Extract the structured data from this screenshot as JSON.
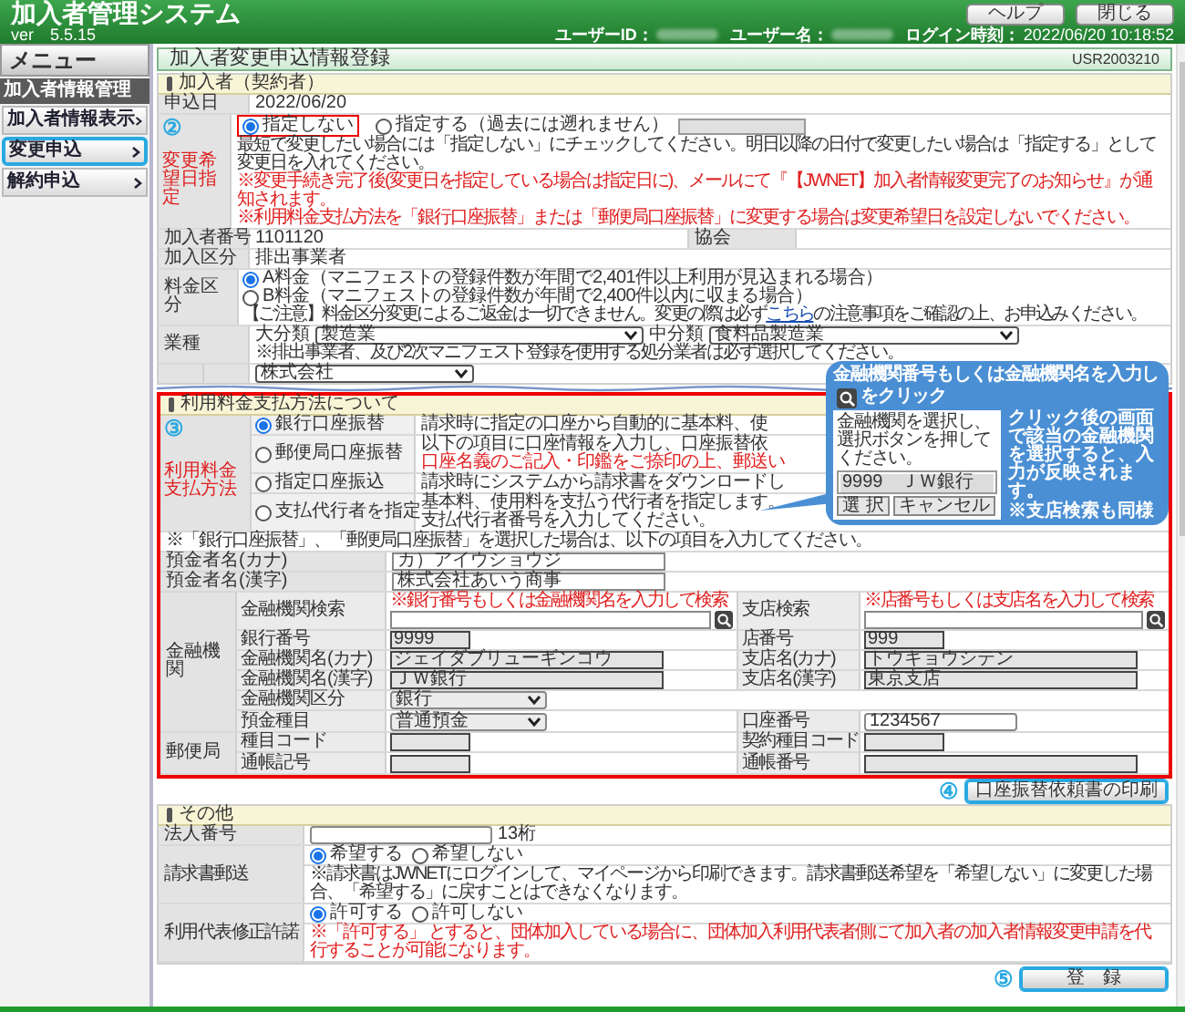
{
  "app": {
    "title": "加入者管理システム",
    "version": "ver　5.5.15",
    "buttons": [
      "ヘルプ",
      "閉じる"
    ],
    "user_id_label": "ユーザーID：",
    "user_name_label": "ユーザー名：",
    "login_label": "ログイン時刻：",
    "login_time": "2022/06/20 10:18:52"
  },
  "menu": {
    "title": "メニュー",
    "group": "加入者情報管理",
    "items": [
      {
        "label": "加入者情報表示",
        "highlighted": false
      },
      {
        "label": "変更申込",
        "highlighted": true
      },
      {
        "label": "解約申込",
        "highlighted": false
      }
    ]
  },
  "page": {
    "title": "加入者変更申込情報登録",
    "code": "USR2003210"
  },
  "applicant": {
    "heading": "加入者（契約者）",
    "date_label": "申込日",
    "date": "2022/06/20",
    "change_date": {
      "label": "変更希望日指定",
      "marker": "②",
      "options": [
        {
          "label": "指定しない",
          "selected": true,
          "highlighted": true
        },
        {
          "label": "指定する（過去には遡れません）",
          "selected": false,
          "highlighted": false
        }
      ],
      "notes": [
        {
          "kind": "plain",
          "text": "最短で変更したい場合には「指定しない」にチェックしてください。明日以降の日付で変更したい場合は「指定する」として変更日を入れてください。"
        },
        {
          "kind": "warning",
          "text": "※変更手続き完了後(変更日を指定している場合は指定日に)、メールにて『【JWNET】加入者情報変更完了のお知らせ』が通知されます。"
        },
        {
          "kind": "warning",
          "text": "※利用料金支払方法を「銀行口座振替」または「郵便局口座振替」に変更する場合は変更希望日を設定しないでください。"
        }
      ]
    },
    "number_label": "加入者番号",
    "number": "1101120",
    "association_label": "協会",
    "type_label": "加入区分",
    "type": "排出事業者",
    "fee": {
      "label": "料金区分",
      "options": [
        {
          "label": "A料金（マニフェストの登録件数が年間で2,401件以上利用が見込まれる場合）",
          "selected": true
        },
        {
          "label": "B料金（マニフェストの登録件数が年間で2,400件以内に収まる場合）",
          "selected": false
        }
      ],
      "note_before": "【ご注意】料金区分変更によるご返金は一切できません。変更の際は必ず",
      "note_link": "こちら",
      "note_after": "の注意事項をご確認の上、お申込みください。"
    },
    "industry": {
      "label": "業種",
      "major_label": "大分類",
      "major": "製造業",
      "minor_label": "中分類",
      "minor": "食料品製造業",
      "note": "※排出事業者、及び2次マニフェスト登録を使用する処分業者は必ず選択してください。"
    },
    "company_type": "株式会社"
  },
  "payment": {
    "heading": "利用料金支払方法について",
    "label": "利用料金支払方法",
    "marker": "③",
    "highlighted": true,
    "options": [
      {
        "label": "銀行口座振替",
        "selected": true,
        "lines": [
          {
            "kind": "plain",
            "text": "請求時に指定の口座から自動的に基本料、使"
          }
        ]
      },
      {
        "label": "郵便局口座振替",
        "selected": false,
        "lines": [
          {
            "kind": "plain",
            "text": "以下の項目に口座情報を入力し、口座振替依"
          },
          {
            "kind": "warning",
            "text": "口座名義のご記入・印鑑をご捺印の上、郵送い"
          }
        ]
      },
      {
        "label": "指定口座振込",
        "selected": false,
        "lines": [
          {
            "kind": "plain",
            "text": "請求時にシステムから請求書をダウンロードし"
          }
        ]
      },
      {
        "label": "支払代行者を指定",
        "selected": false,
        "lines": [
          {
            "kind": "plain",
            "text": "基本料、使用料を支払う代行者を指定します。"
          },
          {
            "kind": "plain",
            "text": "支払代行者番号を入力してください。"
          }
        ]
      }
    ],
    "note": "※「銀行口座振替」、「郵便局口座振替」を選択した場合は、以下の項目を入力してください。",
    "holders": [
      {
        "label": "預金者名(カナ)",
        "value": "カ）アイウショウジ"
      },
      {
        "label": "預金者名(漢字)",
        "value": "株式会社あいう商事"
      }
    ],
    "groups": [
      {
        "label": "金融機関",
        "rows": [
          {
            "cells": [
              {
                "label": "金融機関検索",
                "kind": "search",
                "hint": "※銀行番号もしくは金融機関名を入力して検索"
              },
              {
                "label": "支店検索",
                "kind": "search",
                "hint": "※店番号もしくは支店名を入力して検索"
              }
            ]
          },
          {
            "cells": [
              {
                "label": "銀行番号",
                "kind": "code",
                "value": "9999"
              },
              {
                "label": "店番号",
                "kind": "code",
                "value": "999"
              }
            ]
          },
          {
            "cells": [
              {
                "label": "金融機関名(カナ)",
                "kind": "name",
                "value": "ジェイダブリューギンコウ"
              },
              {
                "label": "支店名(カナ)",
                "kind": "name",
                "value": "トウキョウシテン"
              }
            ]
          },
          {
            "cells": [
              {
                "label": "金融機関名(漢字)",
                "kind": "name",
                "value": "ＪＷ銀行"
              },
              {
                "label": "支店名(漢字)",
                "kind": "name",
                "value": "東京支店"
              }
            ]
          },
          {
            "cells": [
              {
                "label": "金融機関区分",
                "kind": "select",
                "value": "銀行"
              }
            ]
          },
          {
            "cells": [
              {
                "label": "預金種目",
                "kind": "select",
                "value": "普通預金"
              },
              {
                "label": "口座番号",
                "kind": "input",
                "value": "1234567"
              }
            ]
          }
        ]
      },
      {
        "label": "郵便局",
        "rows": [
          {
            "cells": [
              {
                "label": "種目コード",
                "kind": "code"
              },
              {
                "label": "契約種目コード",
                "kind": "code"
              }
            ]
          },
          {
            "cells": [
              {
                "label": "通帳記号",
                "kind": "code"
              },
              {
                "label": "通帳番号",
                "kind": "name"
              }
            ]
          }
        ]
      }
    ],
    "callout": {
      "title_before": "金融機関番号もしくは金融機関名を入力し",
      "title_after": "をクリック",
      "body": "クリック後の画面で該当の金融機関を選択すると、入力が反映されます。",
      "note": "※支店検索も同様",
      "dialog": {
        "prompt": "金融機関を選択し、選択ボタンを押してください。",
        "item": "9999　ＪＷ銀行",
        "buttons": [
          "選 択",
          "キャンセル"
        ]
      }
    }
  },
  "print_button": {
    "label": "口座振替依頼書の印刷",
    "marker": "④",
    "highlighted": true
  },
  "other": {
    "heading": "その他",
    "corp_label": "法人番号",
    "corp_suffix": "13桁",
    "mail": {
      "label": "請求書郵送",
      "options": [
        {
          "label": "希望する",
          "selected": true
        },
        {
          "label": "希望しない",
          "selected": false
        }
      ],
      "note": "※請求書はJWNETにログインして、マイページから印刷できます。請求書郵送希望を「希望しない」に変更した場合、「希望する」に戻すことはできなくなります。"
    },
    "proxy": {
      "label": "利用代表修正許諾",
      "options": [
        {
          "label": "許可する",
          "selected": true
        },
        {
          "label": "許可しない",
          "selected": false
        }
      ],
      "note": "※「許可する」 とすると、団体加入している場合に、団体加入利用代表者側にて加入者の加入者情報変更申請を代行することが可能になります。"
    }
  },
  "submit": {
    "label": "登　録",
    "marker": "⑤",
    "highlighted": true
  }
}
